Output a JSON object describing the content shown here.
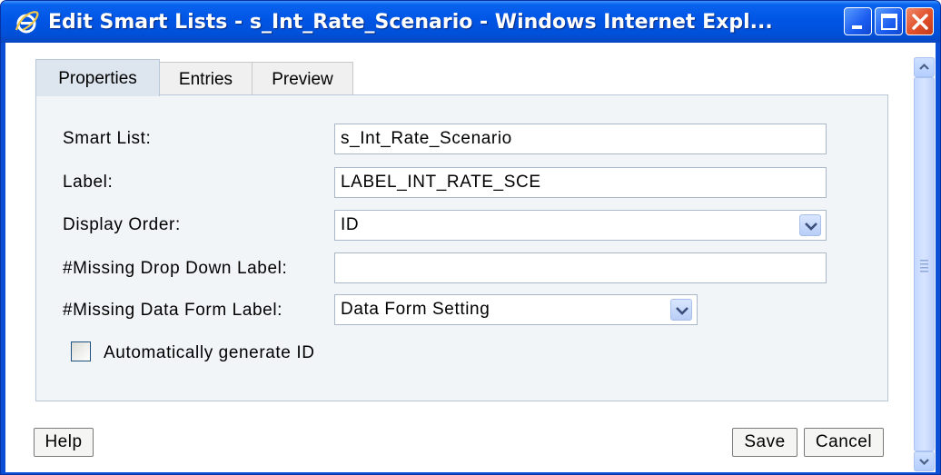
{
  "window": {
    "title": "Edit Smart Lists - s_Int_Rate_Scenario - Windows Internet Expl..."
  },
  "tabs": [
    {
      "label": "Properties",
      "active": true
    },
    {
      "label": "Entries",
      "active": false
    },
    {
      "label": "Preview",
      "active": false
    }
  ],
  "form": {
    "smart_list": {
      "label": "Smart List:",
      "value": "s_Int_Rate_Scenario"
    },
    "label_field": {
      "label": "Label:",
      "value": "LABEL_INT_RATE_SCE"
    },
    "display_order": {
      "label": "Display Order:",
      "value": "ID"
    },
    "missing_drop_down": {
      "label": "#Missing Drop Down Label:",
      "value": ""
    },
    "missing_data_form": {
      "label": "#Missing Data Form Label:",
      "value": "Data Form Setting"
    },
    "auto_generate": {
      "label": "Automatically generate ID",
      "checked": false
    }
  },
  "buttons": {
    "help": "Help",
    "save": "Save",
    "cancel": "Cancel"
  },
  "icons": {
    "app_icon": "internet-explorer-icon",
    "minimize": "minimize-icon",
    "maximize": "maximize-icon",
    "close": "close-icon"
  },
  "colors": {
    "titlebar": "#0055e5",
    "panel": "#f2f5f8",
    "active_tab": "#dde6ef",
    "close_button": "#e0502a"
  }
}
